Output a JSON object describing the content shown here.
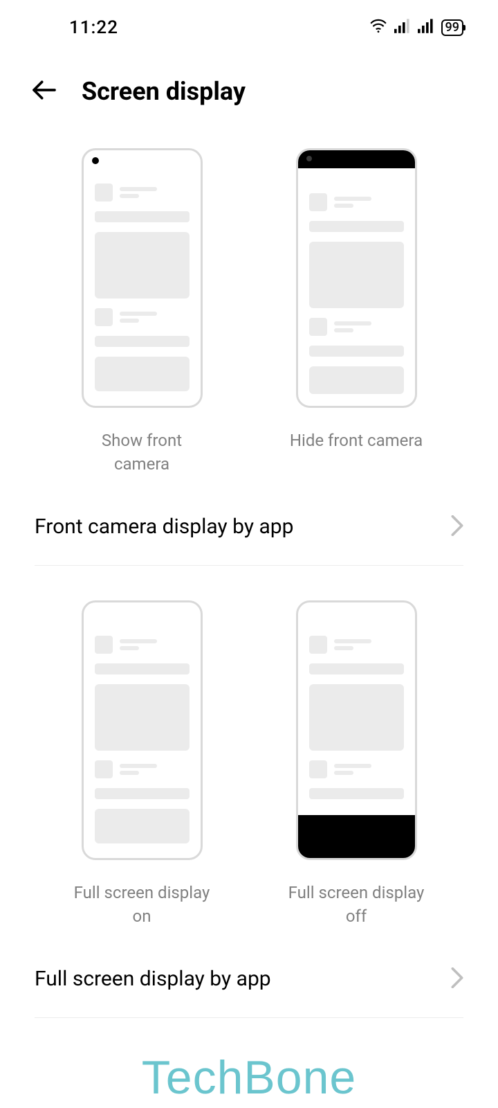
{
  "status": {
    "time": "11:22",
    "battery": "99"
  },
  "header": {
    "title": "Screen display"
  },
  "section1": {
    "optionA": "Show front camera",
    "optionB": "Hide front camera",
    "setting": "Front camera display by app"
  },
  "section2": {
    "optionA": "Full screen display on",
    "optionB": "Full screen display off",
    "setting": "Full screen display by app"
  },
  "watermark": "TechBone"
}
